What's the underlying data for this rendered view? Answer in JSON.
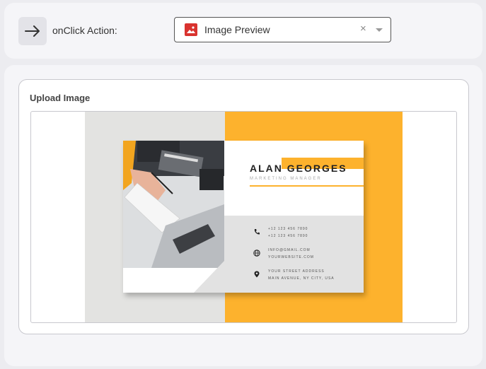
{
  "action": {
    "label": "onClick Action:",
    "icon": "arrow-right-icon",
    "select": {
      "value": "Image Preview",
      "icon": "image-icon",
      "clear": "×"
    }
  },
  "upload": {
    "title": "Upload Image",
    "preview": {
      "colors": {
        "orange": "#fdb22d",
        "gray": "#e3e3e1",
        "red": "#d9332f"
      },
      "card": {
        "name": "ALAN GEORGES",
        "role": "MARKETING MANAGER",
        "phone1": "+12 123 456 7890",
        "phone2": "+12 123 456 7890",
        "email": "INFO@GMAIL.COM",
        "website": "YOURWEBSITE.COM",
        "address1": "YOUR STREET ADDRESS",
        "address2": "MAIN AVENUE, NY CITY, USA"
      }
    }
  }
}
